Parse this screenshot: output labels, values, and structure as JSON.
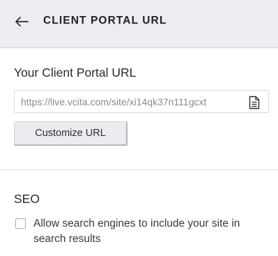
{
  "header": {
    "title": "CLIENT PORTAL URL"
  },
  "portal": {
    "title": "Your Client Portal URL",
    "url": "https://live.vcita.com/site/xi14qk37n111gcxt",
    "customize_label": "Customize URL"
  },
  "seo": {
    "title": "SEO",
    "allow_search_label": "Allow search engines to include your site in search results",
    "allow_search_checked": false
  },
  "icons": {
    "back": "arrow-left-icon",
    "copy": "document-copy-icon"
  }
}
